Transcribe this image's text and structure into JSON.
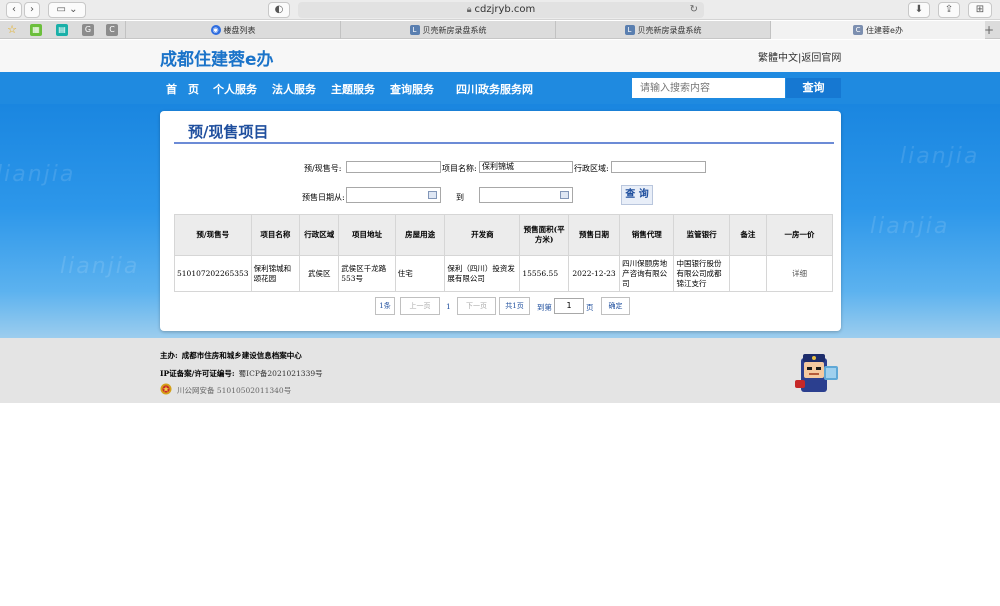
{
  "browser": {
    "url": "cdzjryb.com",
    "tabs": [
      {
        "label": "楼盘列表",
        "icon": "globe-icon"
      },
      {
        "label": "贝壳新房录盘系统",
        "icon": "shell-icon"
      },
      {
        "label": "贝壳新房录盘系统",
        "icon": "shell-icon"
      },
      {
        "label": "住建蓉e办",
        "icon": "page-icon",
        "active": true
      }
    ]
  },
  "header": {
    "logo": "成都住建蓉e办",
    "links": "繁體中文|返回官网"
  },
  "nav": {
    "items": [
      "首　页",
      "个人服务",
      "法人服务",
      "主题服务",
      "查询服务",
      "四川政务服务网"
    ],
    "search_placeholder": "请输入搜索内容",
    "search_button": "查询"
  },
  "page": {
    "title": "预/现售项目",
    "form": {
      "presale_no_label": "预/现售号:",
      "presale_no_value": "",
      "project_name_label": "项目名称:",
      "project_name_value": "保利锦城",
      "district_label": "行政区域:",
      "district_value": "",
      "date_from_label": "预售日期从:",
      "date_to_label": "到",
      "query_button": "查 询"
    },
    "table": {
      "headers": [
        "预/现售号",
        "项目名称",
        "行政区域",
        "项目地址",
        "房屋用途",
        "开发商",
        "预售面积(平方米)",
        "预售日期",
        "销售代理",
        "监管银行",
        "备注",
        "一房一价"
      ],
      "rows": [
        {
          "presale_no": "510107202265353",
          "project_name": "保利锦城和颂花园",
          "district": "武侯区",
          "address": "武侯区千龙路553号",
          "usage": "住宅",
          "developer": "保利（四川）投资发展有限公司",
          "area": "15556.55",
          "date": "2022-12-23",
          "agent": "四川保颐房地产咨询有限公司",
          "bank": "中国银行股份有限公司成都锦江支行",
          "remark": "",
          "price_link": "详细"
        }
      ]
    },
    "pager": {
      "count": "1条",
      "prev": "上一页",
      "current": "1",
      "next": "下一页",
      "total": "共1页",
      "goto_prefix": "到第",
      "goto_value": "1",
      "goto_suffix": "页",
      "confirm": "确定"
    }
  },
  "footer": {
    "sponsor_label": "主办:",
    "sponsor_value": "成都市住房和城乡建设信息档案中心",
    "icp_label": "IP证备案/许可证编号:",
    "icp_value": "蜀ICP备2021021339号",
    "police_record": "川公网安备 51010502011340号"
  }
}
